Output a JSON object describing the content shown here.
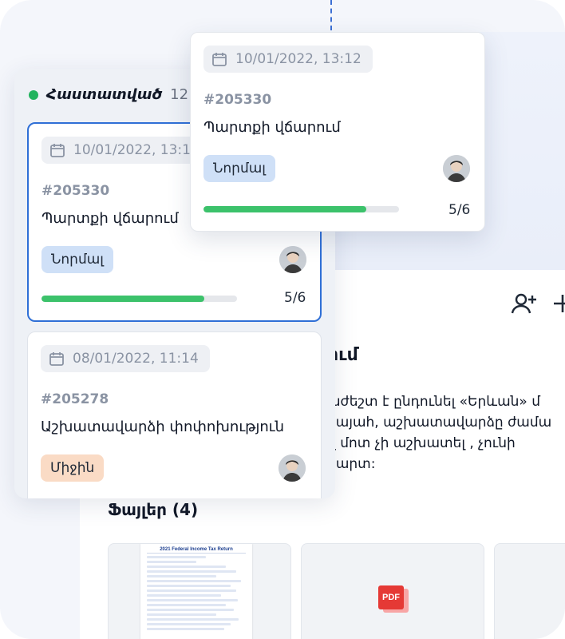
{
  "colors": {
    "accent": "#2f6fd6",
    "status_dot": "#22b35e",
    "progress": "#3cc26b",
    "priority_normal": "#cfe0f7",
    "priority_medium": "#fadbc5"
  },
  "column": {
    "title": "Հաստատված",
    "count": "12"
  },
  "cards": [
    {
      "date": "10/01/2022, 13:12",
      "id": "#205330",
      "title": "Պարտքի վճարում",
      "priority": "Նորմալ",
      "progress_text": "5/6",
      "progress_fraction": 0.833
    },
    {
      "date": "08/01/2022, 11:14",
      "id": "#205278",
      "title": "Աշխատավարձի փոփոխություն",
      "priority": "Միջին"
    }
  ],
  "floating_card": {
    "date": "10/01/2022, 13:12",
    "id": "#205330",
    "title": "Պարտքի վճարում",
    "priority": "Նորմալ",
    "progress_text": "5/6",
    "progress_fraction": 0.833
  },
  "detail": {
    "title": "ում",
    "description_lines": [
      "աժեշտ է ընդունել «Երևան» մ",
      "կայահ, աշխատավարձը ժամա",
      "զ մոտ չի աշխատել , չունի",
      "քարտ:"
    ],
    "files_title": "Ֆայլեր (4)",
    "file_pdf_label": "PDF",
    "doc_title": "2021 Federal Income Tax Return",
    "toolbar_icons": [
      "add-user-icon",
      "plus-icon"
    ]
  }
}
